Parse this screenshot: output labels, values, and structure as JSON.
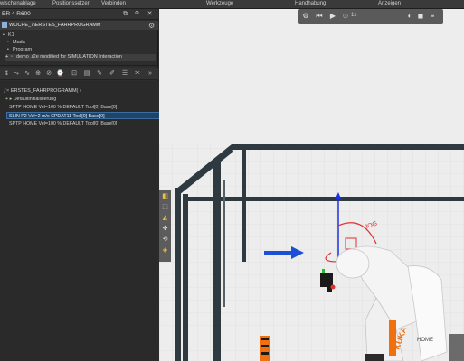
{
  "menu": {
    "items": [
      "wischenablage",
      "Positionssetzer",
      "Verbinden",
      "Werkzeuge",
      "Handhabung",
      "Anzeigen"
    ]
  },
  "panel": {
    "title": "ER 4 R600",
    "station": "WOCHE_7\\ERSTES_FAHRPROGRAMM",
    "tree": [
      {
        "label": "K1"
      },
      {
        "label": "Mada"
      },
      {
        "label": "Program"
      },
      {
        "label": "demo .r2e  modified for SIMULATION  Interaction"
      }
    ]
  },
  "program": {
    "title": "ERSTES_FAHRPROGRAMM( )",
    "lines": [
      "Defaultinitialisierung",
      "SPTP HOME Vel=100 % DEFAULT Tool[0] Base[0]",
      "SLIN P2 Vel=2 m/s CPDAT11 Tool[0] Base[0]",
      "SPTP HOME Vel=100 % DEFAULT Tool[0] Base[0]"
    ],
    "selected_index": 2
  },
  "view_toolbar": {
    "speed_text": "1x"
  },
  "scene": {
    "brand_text": "KUKA",
    "home_text": "HOME",
    "colors": {
      "frame": "#2e3a40",
      "robot": "#f4f4f4",
      "arrow": "#1a4fd6",
      "axis_red": "#e03030",
      "axis_green": "#22c030",
      "axis_blue": "#2030e0",
      "orange": "#f07010"
    }
  }
}
